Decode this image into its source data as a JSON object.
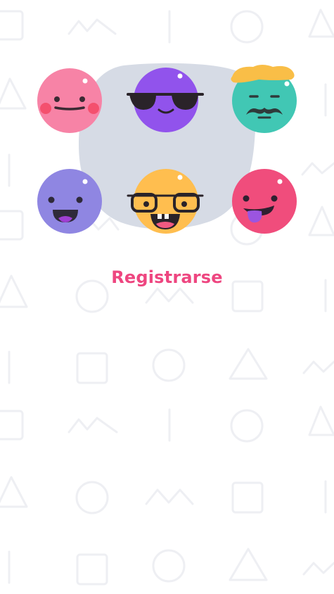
{
  "screen": {
    "title": "Registrarse",
    "accent_color": "#ee4680",
    "pattern_color": "#eeeef2",
    "highlight_color": "#d5dae4"
  },
  "avatars": [
    {
      "id": "pink-blush",
      "color": "#f783a6",
      "selected": false
    },
    {
      "id": "purple-sunglasses",
      "color": "#9153ec",
      "selected": true
    },
    {
      "id": "teal-mustache",
      "color": "#41c7b4",
      "selected": false
    },
    {
      "id": "lavender-smile",
      "color": "#8f86e2",
      "selected": false
    },
    {
      "id": "yellow-glasses",
      "color": "#ffbe4f",
      "selected": true
    },
    {
      "id": "red-tongue",
      "color": "#f04d7c",
      "selected": false
    }
  ]
}
